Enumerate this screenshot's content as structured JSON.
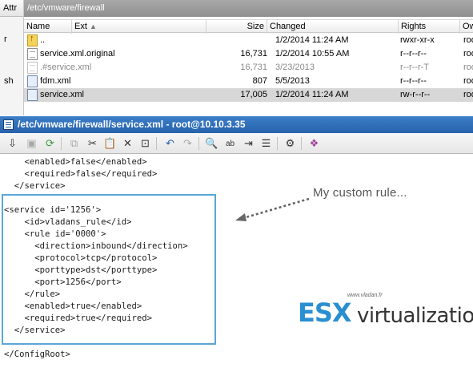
{
  "file_browser": {
    "path": "/etc/vmware/firewall",
    "left_panel": {
      "header": "Attr",
      "values": [
        "r",
        "sh"
      ]
    },
    "columns": {
      "name": "Name",
      "ext": "Ext",
      "size": "Size",
      "changed": "Changed",
      "rights": "Rights",
      "owner": "Ow"
    },
    "rows": [
      {
        "name": "..",
        "size": "",
        "changed": "1/2/2014 11:24 AM",
        "rights": "rwxr-xr-x",
        "owner": "roo",
        "icon": "folder-up-icon"
      },
      {
        "name": "service.xml.original",
        "size": "16,731",
        "changed": "1/2/2014 10:55 AM",
        "rights": "r--r--r--",
        "owner": "roo",
        "icon": "file-icon"
      },
      {
        "name": ".#service.xml",
        "size": "16,731",
        "changed": "3/23/2013",
        "rights": "r--r--r-T",
        "owner": "roo",
        "icon": "file-icon"
      },
      {
        "name": "fdm.xml",
        "size": "807",
        "changed": "5/5/2013",
        "rights": "r--r--r--",
        "owner": "roo",
        "icon": "xml-file-icon"
      },
      {
        "name": "service.xml",
        "size": "17,005",
        "changed": "1/2/2014 11:24 AM",
        "rights": "rw-r--r--",
        "owner": "roo",
        "icon": "xml-file-icon"
      }
    ]
  },
  "editor": {
    "title": "/etc/vmware/firewall/service.xml - root@10.10.3.35",
    "lines": [
      "    <enabled>false</enabled>",
      "    <required>false</required>",
      "  </service>",
      "",
      "<service id='1256'>",
      "    <id>vladans_rule</id>",
      "    <rule id='0000'>",
      "      <direction>inbound</direction>",
      "      <protocol>tcp</protocol>",
      "      <porttype>dst</porttype>",
      "      <port>1256</port>",
      "    </rule>",
      "    <enabled>true</enabled>",
      "    <required>true</required>",
      "  </service>",
      "",
      "</ConfigRoot>"
    ]
  },
  "annotation": "My custom rule...",
  "watermark": {
    "url": "www.vladan.fr",
    "brand_left": "ESX",
    "brand_right": "virtualization"
  },
  "colors": {
    "title_bar": "#2762ac",
    "highlight_box": "#5aa6d8",
    "logo_blue": "#2a8fd0"
  }
}
